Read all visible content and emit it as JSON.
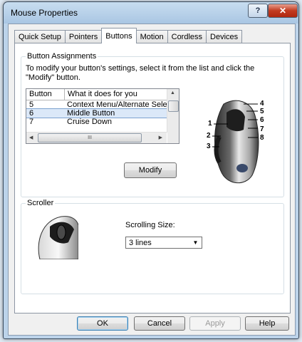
{
  "window": {
    "title": "Mouse Properties",
    "help_glyph": "?",
    "close_glyph": "✕"
  },
  "tabs": [
    {
      "label": "Quick Setup"
    },
    {
      "label": "Pointers"
    },
    {
      "label": "Buttons"
    },
    {
      "label": "Motion"
    },
    {
      "label": "Cordless"
    },
    {
      "label": "Devices"
    }
  ],
  "button_assignments": {
    "legend": "Button Assignments",
    "instructions": "To modify your button's settings, select it from the list and click the \"Modify\" button.",
    "columns": [
      "Button",
      "What it does for you"
    ],
    "rows": [
      {
        "button": "5",
        "action": "Context Menu/Alternate Select"
      },
      {
        "button": "6",
        "action": "Middle Button"
      },
      {
        "button": "7",
        "action": "Cruise Down"
      }
    ],
    "selected_row": "6",
    "modify_label": "Modify",
    "hscroll_grip": "III",
    "mouse_numbers": [
      "1",
      "2",
      "3",
      "4",
      "5",
      "6",
      "7",
      "8"
    ]
  },
  "scroller": {
    "legend": "Scroller",
    "scrolling_size_label": "Scrolling Size:",
    "scrolling_size_value": "3 lines"
  },
  "footer": {
    "ok": "OK",
    "cancel": "Cancel",
    "apply": "Apply",
    "help": "Help"
  },
  "colors": {
    "accent": "#3c7fb1",
    "selection": "#dbe8f8",
    "close": "#c23a20"
  }
}
